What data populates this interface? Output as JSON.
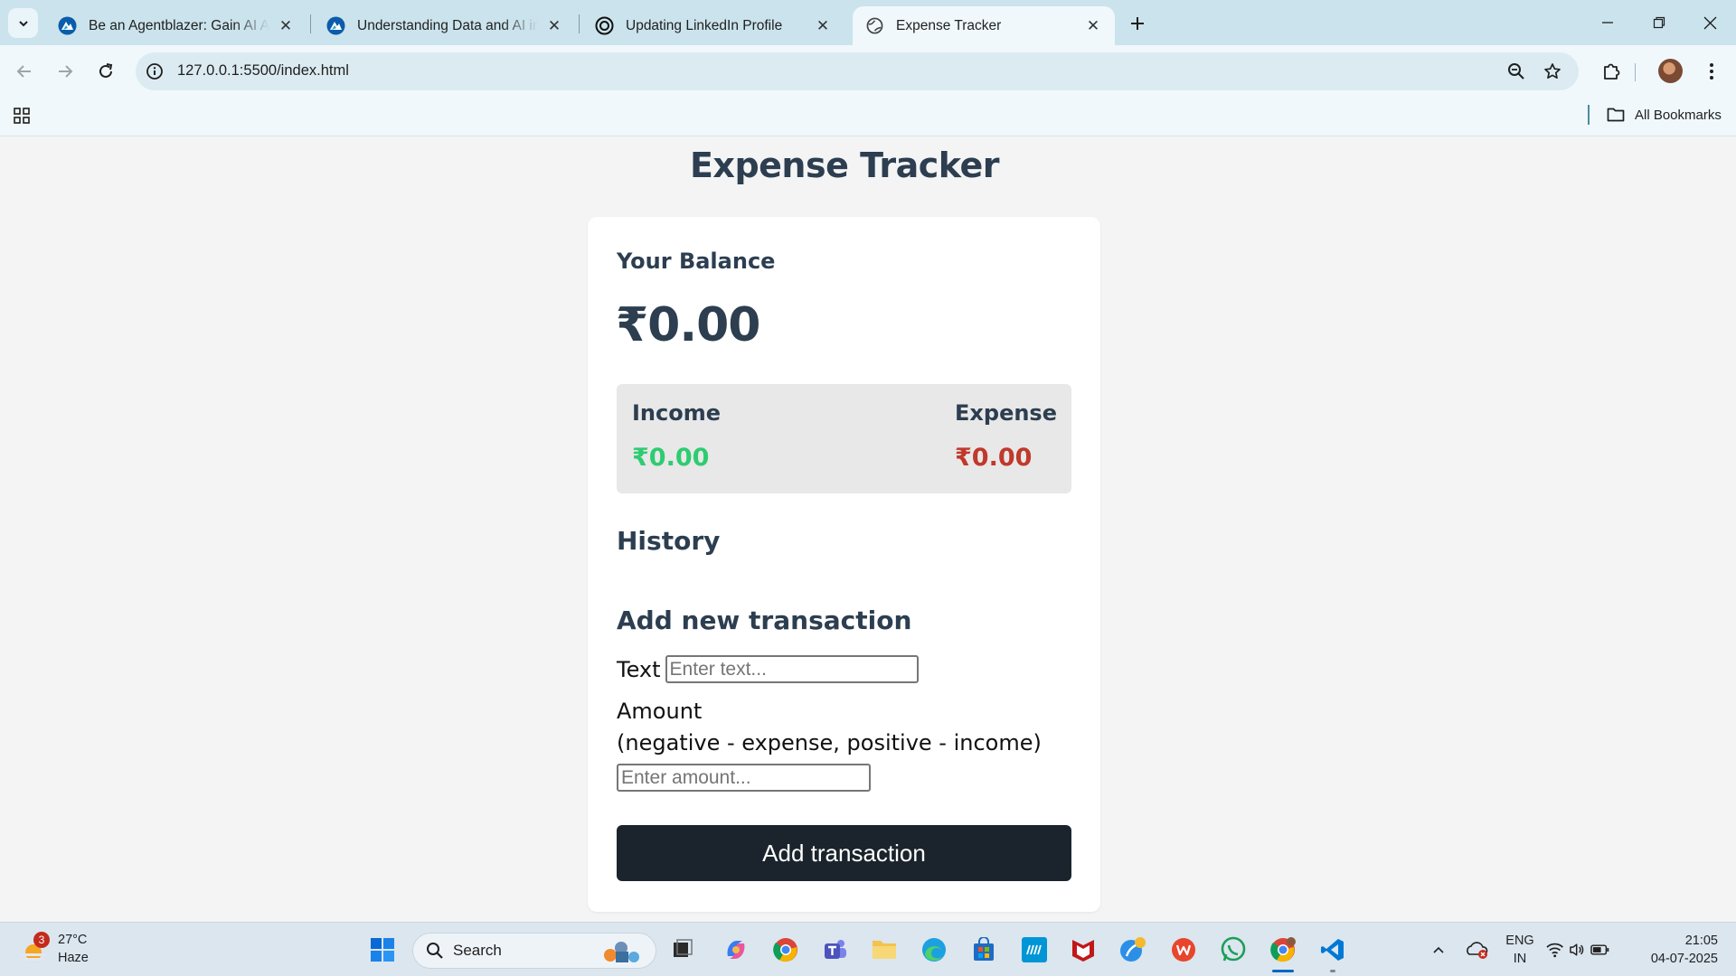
{
  "browser": {
    "tabs": [
      {
        "title": "Be an Agentblazer: Gain AI Age",
        "active": false
      },
      {
        "title": "Understanding Data and AI in M",
        "active": false
      },
      {
        "title": "Updating LinkedIn Profile",
        "active": false
      },
      {
        "title": "Expense Tracker",
        "active": true
      }
    ],
    "url": "127.0.0.1:5500/index.html",
    "bookmarks_label": "All Bookmarks"
  },
  "app": {
    "title": "Expense Tracker",
    "balance_label": "Your Balance",
    "balance_value": "₹0.00",
    "income_label": "Income",
    "income_value": "₹0.00",
    "expense_label": "Expense",
    "expense_value": "₹0.00",
    "history_label": "History",
    "add_heading": "Add new transaction",
    "text_label": "Text",
    "text_placeholder": "Enter text...",
    "amount_label": "Amount",
    "amount_hint": "(negative - expense, positive - income)",
    "amount_placeholder": "Enter amount...",
    "add_button": "Add transaction",
    "colors": {
      "income": "#2ecc71",
      "expense": "#c0392b",
      "text": "#2c3e50",
      "button": "#1b242c"
    }
  },
  "taskbar": {
    "weather_badge": "3",
    "weather_temp": "27°C",
    "weather_desc": "Haze",
    "search_label": "Search",
    "lang_line1": "ENG",
    "lang_line2": "IN",
    "time": "21:05",
    "date": "04-07-2025"
  }
}
